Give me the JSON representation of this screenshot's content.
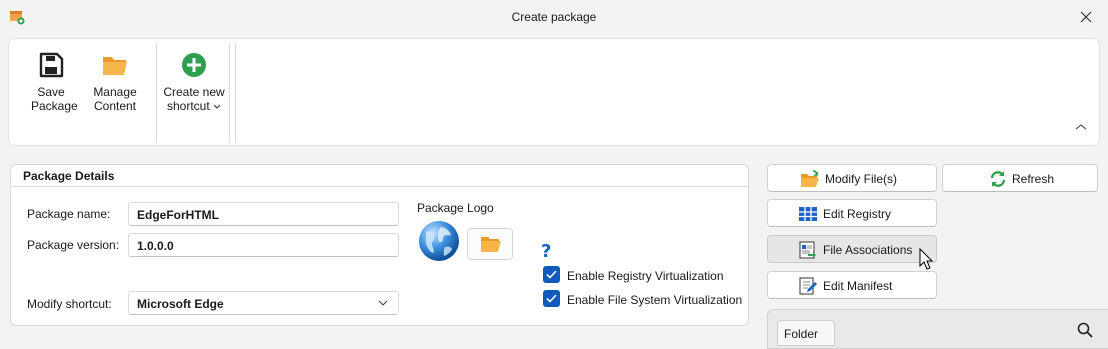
{
  "window": {
    "title": "Create package"
  },
  "ribbon": {
    "save": {
      "line1": "Save",
      "line2": "Package"
    },
    "manage": {
      "line1": "Manage",
      "line2": "Content"
    },
    "shortcut": {
      "line1": "Create new",
      "line2": "shortcut"
    }
  },
  "details": {
    "header": "Package Details",
    "name_label": "Package name:",
    "name_value": "EdgeForHTML",
    "version_label": "Package version:",
    "version_value": "1.0.0.0",
    "shortcut_label": "Modify shortcut:",
    "shortcut_value": "Microsoft Edge",
    "logo_label": "Package Logo",
    "help_glyph": "?",
    "registry_virt_label": "Enable Registry Virtualization",
    "registry_virt_checked": true,
    "fs_virt_label": "Enable File System Virtualization",
    "fs_virt_checked": true
  },
  "actions": {
    "modify_files": "Modify File(s)",
    "refresh": "Refresh",
    "edit_registry": "Edit Registry",
    "file_associations": "File Associations",
    "edit_manifest": "Edit Manifest"
  },
  "files_panel": {
    "folder_tab": "Folder"
  },
  "colors": {
    "accent": "#0f5bbd",
    "add_green": "#2e9e4f",
    "folder_orange": "#f0a830"
  }
}
